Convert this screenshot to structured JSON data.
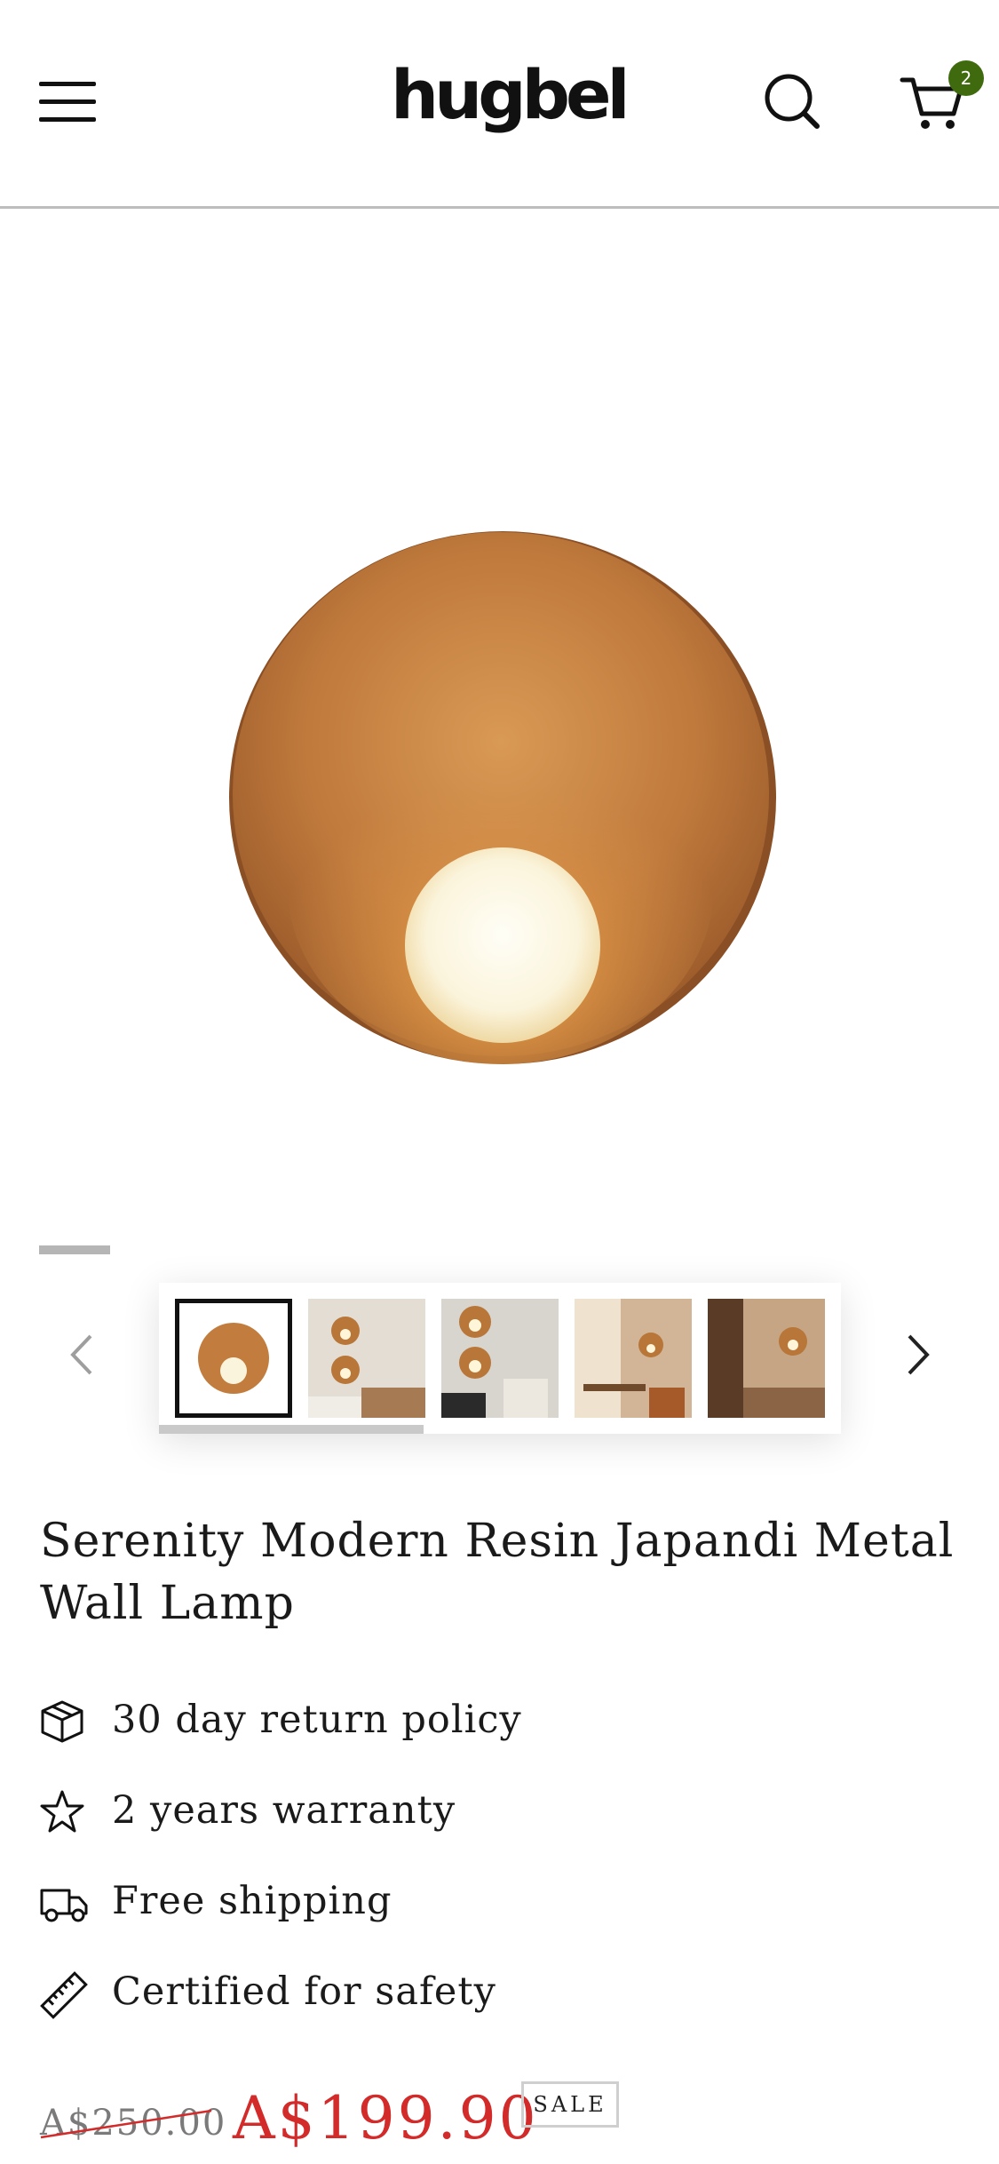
{
  "header": {
    "logo": "hugbel",
    "cart_count": "2"
  },
  "product": {
    "title": "Serenity Modern Resin Japandi Metal Wall Lamp",
    "features": [
      {
        "icon": "box-icon",
        "label": "30 day return policy"
      },
      {
        "icon": "star-icon",
        "label": "2 years warranty"
      },
      {
        "icon": "truck-icon",
        "label": "Free shipping"
      },
      {
        "icon": "ruler-icon",
        "label": "Certified for safety"
      }
    ],
    "price_original": "A$250.00",
    "price_sale": "A$199.90",
    "sale_badge": "SALE"
  },
  "gallery": {
    "thumbnail_count": 5,
    "active_index": 0
  },
  "colors": {
    "accent_sale": "#d32a2a",
    "badge_green": "#3f6b0e"
  }
}
